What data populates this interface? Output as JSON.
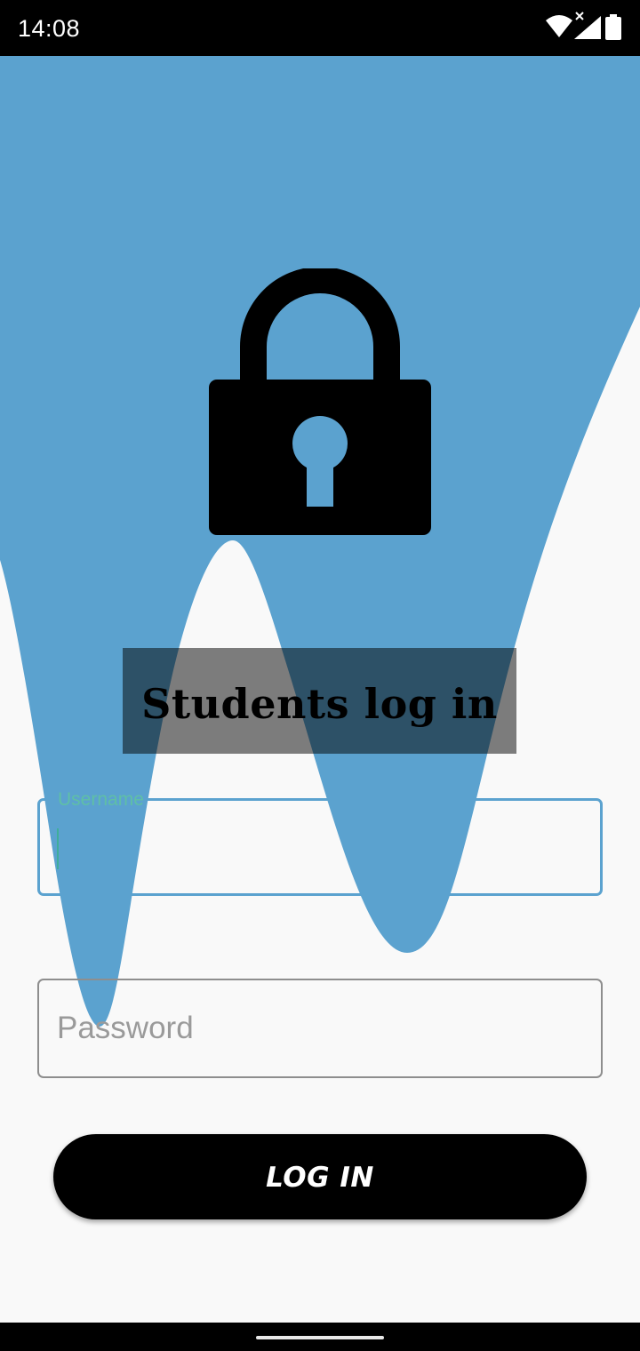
{
  "status_bar": {
    "time": "14:08",
    "icons": [
      "wifi-icon",
      "cellular-signal-icon",
      "battery-icon"
    ]
  },
  "login": {
    "title": "Students log in",
    "username_label": "Username",
    "username_value": "",
    "password_placeholder": "Password",
    "password_value": "",
    "submit_label": "LOG IN"
  },
  "colors": {
    "wave": "#5ba2cf",
    "background": "#f9f9f9",
    "focus_label": "#5fbfa6",
    "button": "#000000"
  },
  "decor": {
    "lock_icon": "padlock-icon"
  }
}
